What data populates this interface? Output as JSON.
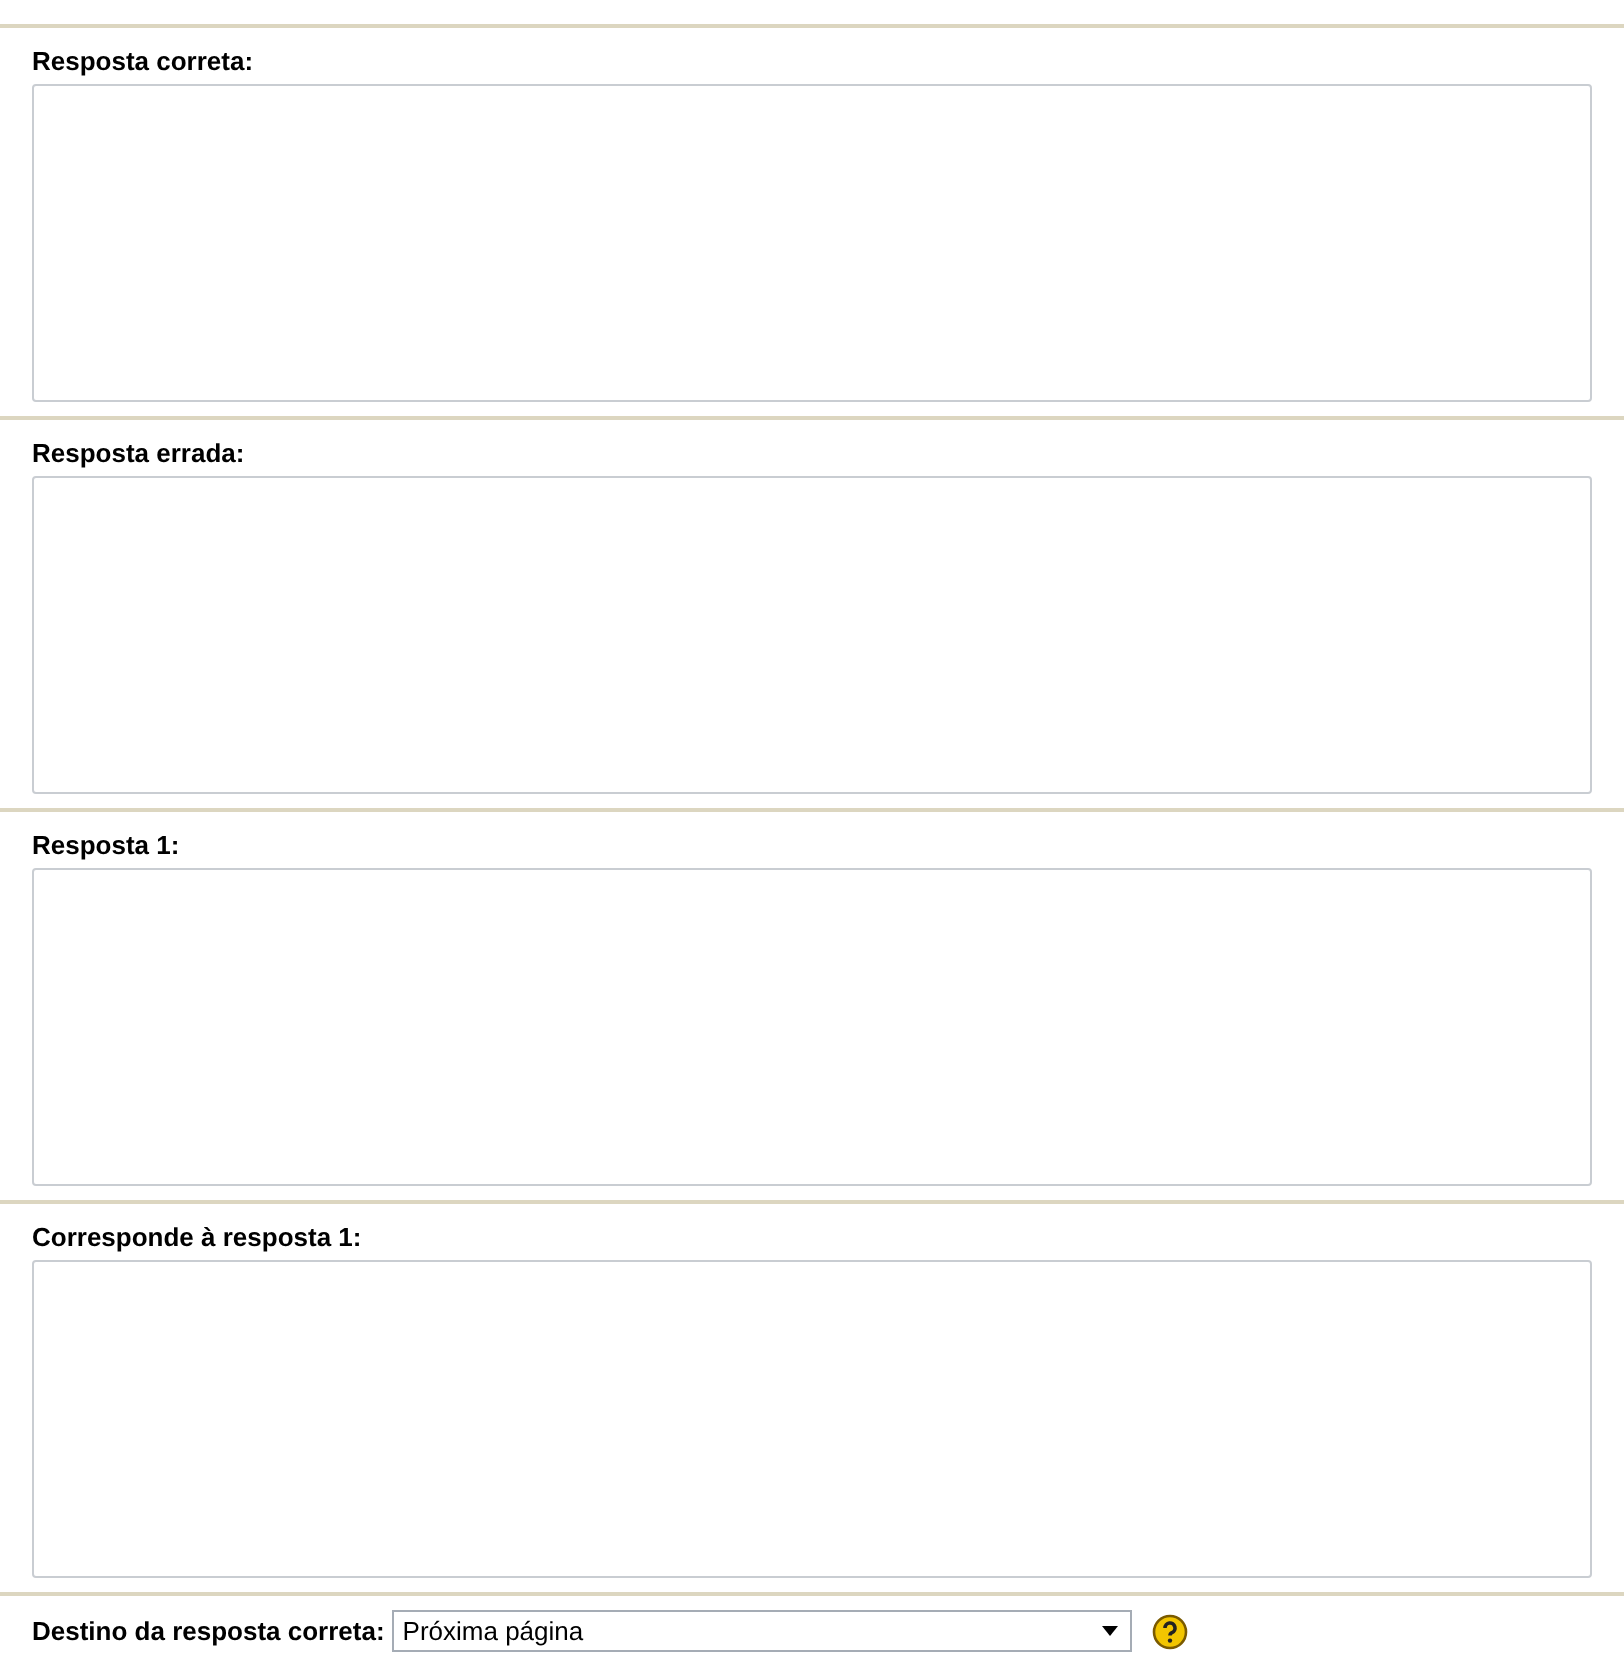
{
  "fields": [
    {
      "label": "Resposta correta:"
    },
    {
      "label": "Resposta errada:"
    },
    {
      "label": "Resposta 1:"
    },
    {
      "label": "Corresponde à resposta 1:"
    }
  ],
  "destination": {
    "label": "Destino da resposta correta:",
    "value": "Próxima página"
  }
}
